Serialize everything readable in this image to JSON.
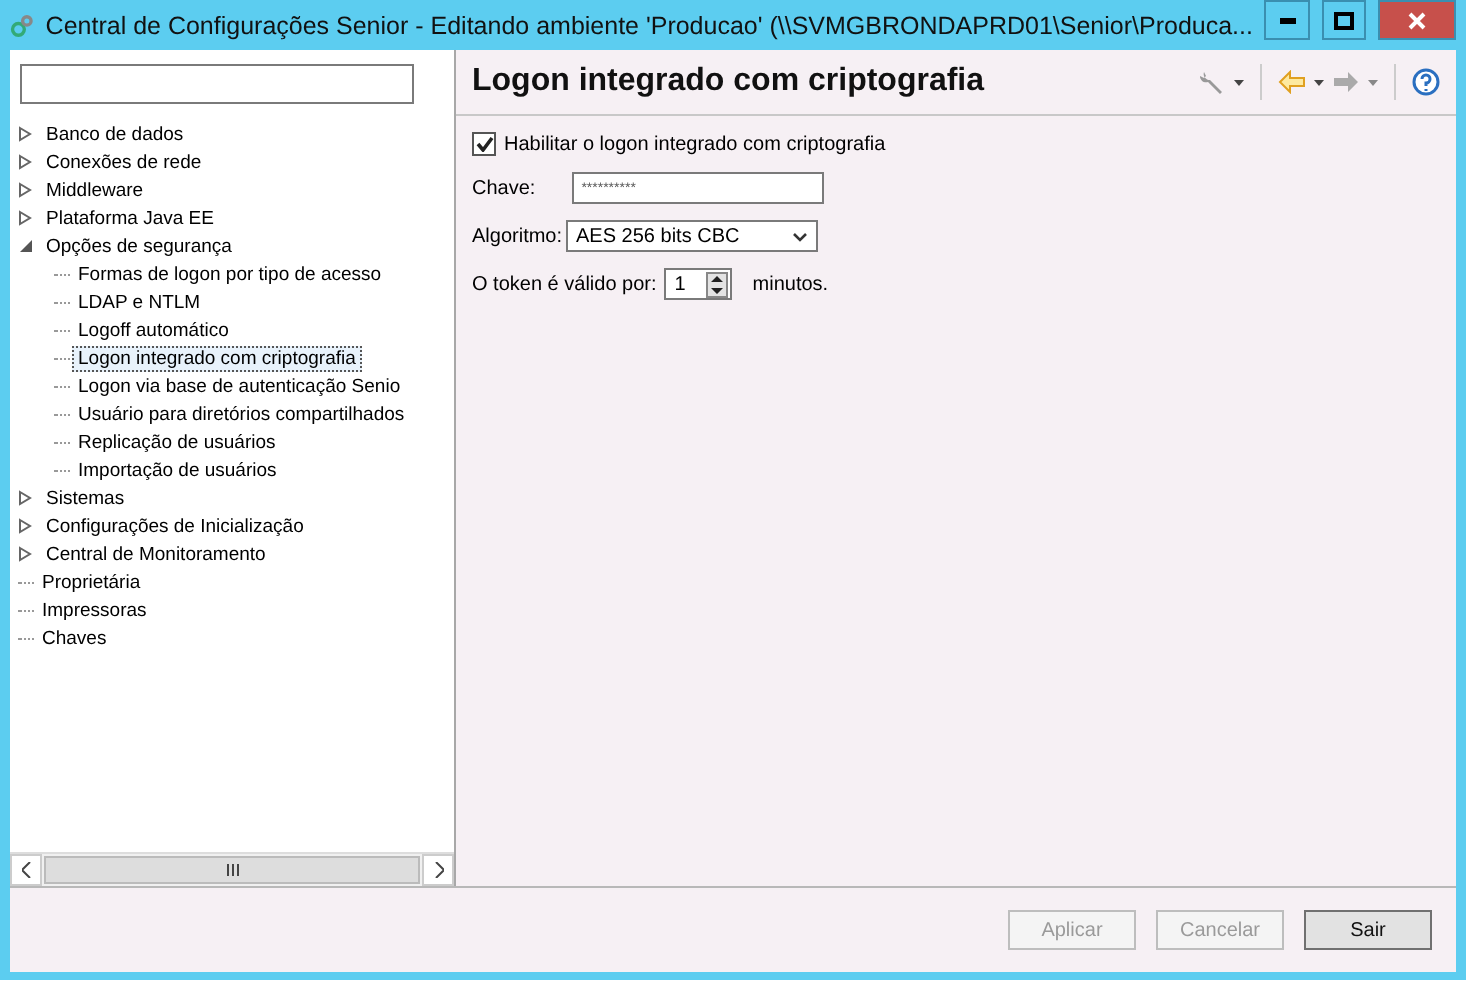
{
  "window": {
    "title": "Central de Configurações Senior - Editando ambiente 'Producao' (\\\\SVMGBRONDAPRD01\\Senior\\Produca..."
  },
  "sidebar": {
    "tree": [
      {
        "label": "Banco de dados",
        "expanded": false,
        "selected": false
      },
      {
        "label": "Conexões de rede",
        "expanded": false,
        "selected": false
      },
      {
        "label": "Middleware",
        "expanded": false,
        "selected": false
      },
      {
        "label": "Plataforma Java EE",
        "expanded": false,
        "selected": false
      },
      {
        "label": "Opções de segurança",
        "expanded": true,
        "selected": false,
        "children": [
          {
            "label": "Formas de logon por tipo de acesso",
            "selected": false
          },
          {
            "label": "LDAP e NTLM",
            "selected": false
          },
          {
            "label": "Logoff automático",
            "selected": false
          },
          {
            "label": "Logon integrado com criptografia",
            "selected": true
          },
          {
            "label": "Logon via base de autenticação Senio",
            "selected": false
          },
          {
            "label": "Usuário para diretórios compartilhados",
            "selected": false
          },
          {
            "label": "Replicação de usuários",
            "selected": false
          },
          {
            "label": "Importação de usuários",
            "selected": false
          }
        ]
      },
      {
        "label": "Sistemas",
        "expanded": false,
        "selected": false
      },
      {
        "label": "Configurações de Inicialização",
        "expanded": false,
        "selected": false
      },
      {
        "label": "Central de Monitoramento",
        "expanded": false,
        "selected": false
      },
      {
        "label": "Proprietária",
        "selected": false
      },
      {
        "label": "Impressoras",
        "selected": false
      },
      {
        "label": "Chaves",
        "selected": false
      }
    ]
  },
  "panel": {
    "title": "Logon integrado com criptografia",
    "enable": {
      "label": "Habilitar o logon integrado com criptografia",
      "checked": true
    },
    "key": {
      "label": "Chave:",
      "value": "**********"
    },
    "algorithm": {
      "label": "Algoritmo:",
      "value": "AES 256 bits CBC"
    },
    "token": {
      "label": "O token é válido por:",
      "value": "1",
      "unit": "minutos."
    }
  },
  "buttons": [
    {
      "label": "Aplicar",
      "disabled": true
    },
    {
      "label": "Cancelar",
      "disabled": true
    },
    {
      "label": "Sair",
      "disabled": false
    }
  ]
}
